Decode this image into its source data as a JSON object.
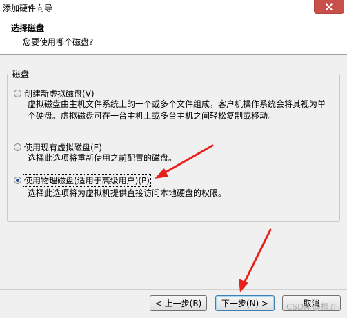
{
  "window": {
    "title": "添加硬件向导"
  },
  "header": {
    "title": "选择磁盘",
    "subtitle": "您要使用哪个磁盘?"
  },
  "group": {
    "legend": "磁盘"
  },
  "options": [
    {
      "label": "创建新虚拟磁盘(V)",
      "description_line1": "虚拟磁盘由主机文件系统上的一个或多个文件组成，客户机操作系统会将其视为单",
      "description_line2": "个硬盘。虚拟磁盘可在一台主机上或多台主机之间轻松复制或移动。",
      "selected": false
    },
    {
      "label": "使用现有虚拟磁盘(E)",
      "description_line1": "选择此选项将重新使用之前配置的磁盘。",
      "selected": false
    },
    {
      "label": "使用物理磁盘(适用于高级用户)(P)",
      "description_line1": "选择此选项将为虚拟机提供直接访问本地硬盘的权限。",
      "selected": true
    }
  ],
  "buttons": {
    "back": "< 上一步(B)",
    "next": "下一步(N) >",
    "cancel": "取消"
  },
  "watermark": "CSDN @枫弃",
  "colors": {
    "annotation_arrow": "#e8201c",
    "radio_dot": "#1f4fa3"
  }
}
